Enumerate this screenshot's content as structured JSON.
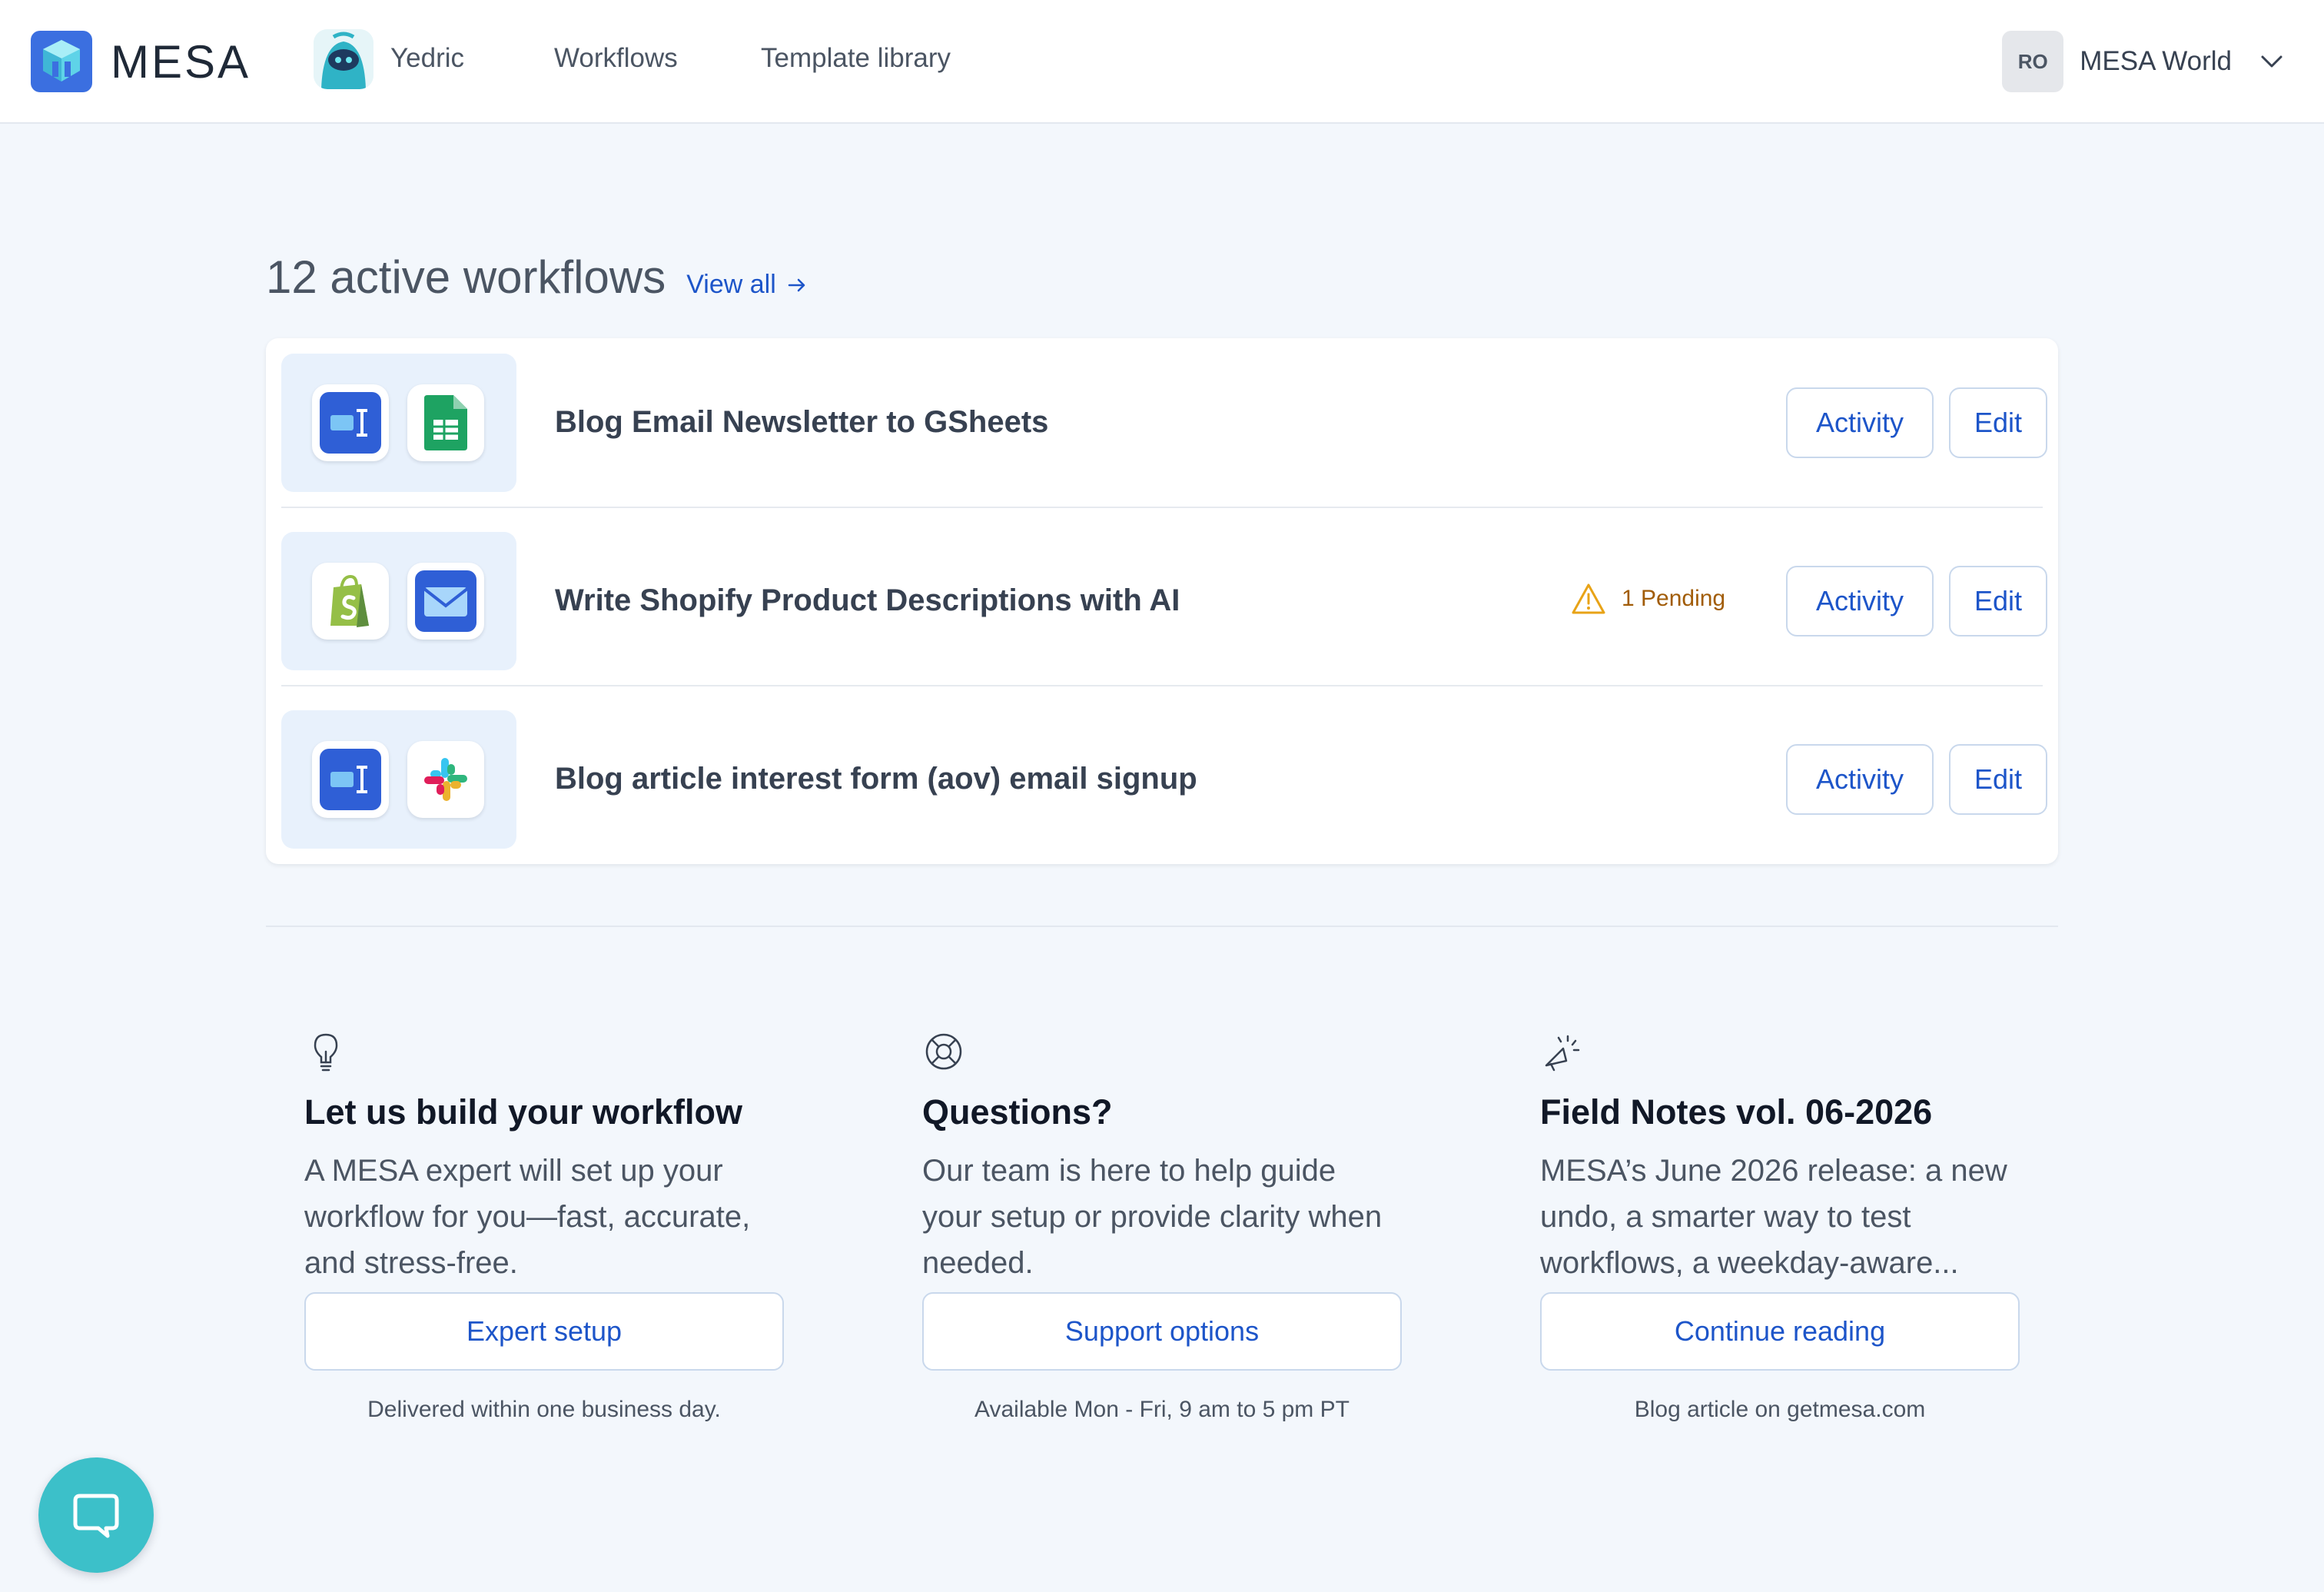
{
  "brand": {
    "name": "MESA",
    "logo_icon": "mesa-logo-icon"
  },
  "nav": {
    "items": [
      {
        "label": "Yedric",
        "icon": "yedric-avatar-icon"
      },
      {
        "label": "Workflows"
      },
      {
        "label": "Template library"
      }
    ]
  },
  "account": {
    "initials": "RO",
    "name": "MESA World",
    "icon": "chevron-down-icon"
  },
  "workflows": {
    "title": "12 active workflows",
    "view_all": "View all",
    "items": [
      {
        "name": "Blog Email Newsletter to GSheets",
        "icons": [
          "mesa-form-icon",
          "google-sheets-icon"
        ],
        "activity": "Activity",
        "edit": "Edit"
      },
      {
        "name": "Write Shopify Product Descriptions with AI",
        "icons": [
          "shopify-icon",
          "email-icon"
        ],
        "pending": "1 Pending",
        "activity": "Activity",
        "edit": "Edit"
      },
      {
        "name": "Blog article interest form (aov) email signup",
        "icons": [
          "mesa-form-icon",
          "slack-icon"
        ],
        "activity": "Activity",
        "edit": "Edit"
      }
    ]
  },
  "info": [
    {
      "icon": "lightbulb-icon",
      "title": "Let us build your workflow",
      "desc": "A MESA expert will set up your workflow for you—fast, accurate, and stress-free.",
      "button": "Expert setup",
      "note": "Delivered within one business day."
    },
    {
      "icon": "lifebuoy-icon",
      "title": "Questions?",
      "desc": "Our team is here to help guide your setup or provide clarity when needed.",
      "button": "Support options",
      "note": "Available Mon - Fri, 9 am to 5 pm PT"
    },
    {
      "icon": "megaphone-icon",
      "title": "Field Notes vol. 06-2026",
      "desc": "MESA’s June 2026 release: a new undo, a smarter way to test workflows, a weekday-aware...",
      "button": "Continue reading",
      "note": "Blog article on getmesa.com"
    }
  ],
  "chat": {
    "icon": "chat-bubble-icon"
  },
  "colors": {
    "accent": "#1d55c9",
    "background": "#f3f7fc",
    "chat": "#3cc0c9",
    "pending": "#a15c07"
  }
}
